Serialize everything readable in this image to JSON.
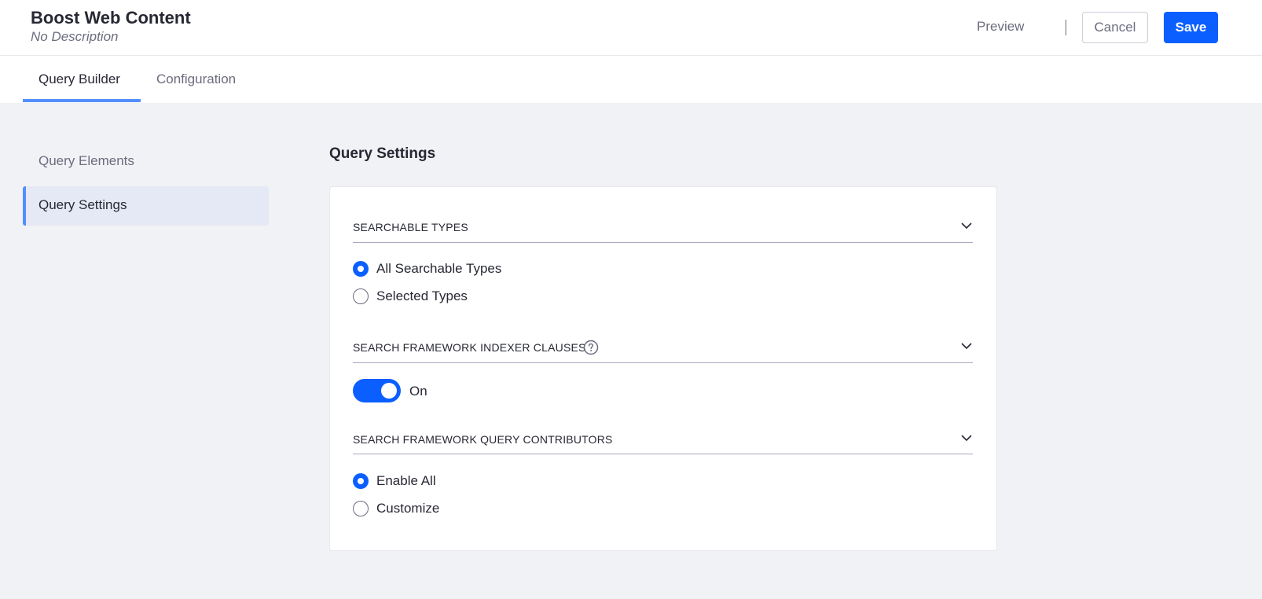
{
  "header": {
    "title": "Boost Web Content",
    "subtitle": "No Description",
    "preview_label": "Preview",
    "cancel_label": "Cancel",
    "save_label": "Save"
  },
  "tabs": [
    {
      "label": "Query Builder",
      "active": true
    },
    {
      "label": "Configuration",
      "active": false
    }
  ],
  "sidebar": {
    "items": [
      {
        "label": "Query Elements",
        "active": false
      },
      {
        "label": "Query Settings",
        "active": true
      }
    ]
  },
  "main": {
    "title": "Query Settings",
    "sections": [
      {
        "label": "SEARCHABLE TYPES",
        "options": [
          {
            "label": "All Searchable Types",
            "selected": true
          },
          {
            "label": "Selected Types",
            "selected": false
          }
        ]
      },
      {
        "label": "SEARCH FRAMEWORK INDEXER CLAUSES",
        "help_icon": "question-circle-icon",
        "toggle_on": true,
        "toggle_label": "On"
      },
      {
        "label": "SEARCH FRAMEWORK QUERY CONTRIBUTORS",
        "options": [
          {
            "label": "Enable All",
            "selected": true
          },
          {
            "label": "Customize",
            "selected": false
          }
        ]
      }
    ]
  },
  "colors": {
    "primary": "#0b5fff",
    "accent": "#528eff",
    "background": "#f1f2f5",
    "text": "#272833",
    "muted_text": "#6b6c7e",
    "active_sidebar_bg": "#e5e9f5"
  },
  "icons": [
    "chevron-down-icon",
    "question-circle-icon"
  ]
}
